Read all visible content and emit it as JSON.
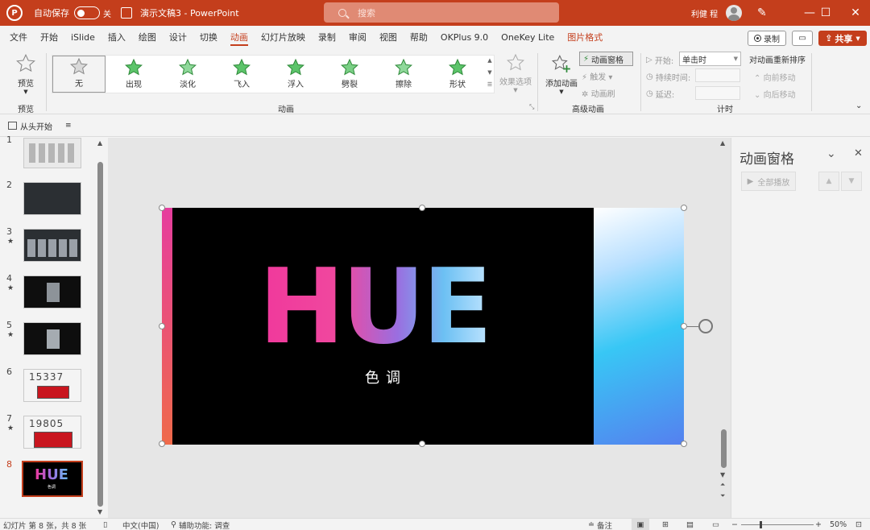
{
  "titlebar": {
    "app_icon": "P",
    "autosave_label": "自动保存",
    "autosave_state": "关",
    "doc_title": "演示文稿3  -  PowerPoint",
    "search_placeholder": "搜索",
    "user_name": "利健 程",
    "minimize": "—",
    "maximize": "☐",
    "close": "✕"
  },
  "menu": {
    "items": [
      "文件",
      "开始",
      "iSlide",
      "插入",
      "绘图",
      "设计",
      "切换",
      "动画",
      "幻灯片放映",
      "录制",
      "审阅",
      "视图",
      "帮助",
      "OKPlus 9.0",
      "OneKey Lite",
      "图片格式"
    ],
    "active_index": 7,
    "context_index": 15,
    "record_label": "录制",
    "share_label": "共享"
  },
  "ribbon": {
    "preview_label": "预览",
    "preview_group": "预览",
    "animations": [
      "无",
      "出现",
      "淡化",
      "飞入",
      "浮入",
      "劈裂",
      "擦除",
      "形状"
    ],
    "selected_animation": 0,
    "animation_group": "动画",
    "effect_options": "效果选项",
    "add_animation": "添加动画",
    "animation_pane": "动画窗格",
    "trigger": "触发",
    "painter": "动画刷",
    "advanced_group": "高级动画",
    "start_label": "开始:",
    "start_value": "单击时",
    "duration_label": "持续时间:",
    "delay_label": "延迟:",
    "timing_group": "计时",
    "reorder_title": "对动画重新排序",
    "move_earlier": "向前移动",
    "move_later": "向后移动"
  },
  "qat": {
    "play_from_start": "从头开始"
  },
  "thumbnails": [
    {
      "num": "1",
      "star": ""
    },
    {
      "num": "2",
      "star": ""
    },
    {
      "num": "3",
      "star": "★"
    },
    {
      "num": "4",
      "star": "★"
    },
    {
      "num": "5",
      "star": "★"
    },
    {
      "num": "6",
      "star": ""
    },
    {
      "num": "7",
      "star": "★"
    },
    {
      "num": "8",
      "star": ""
    }
  ],
  "thumb_text": {
    "t6": "15337",
    "t7": "19805",
    "t8": "HUE",
    "t8_sub": "色调"
  },
  "slide": {
    "title": "HUE",
    "subtitle": "色调"
  },
  "pane": {
    "title": "动画窗格",
    "play_all": "全部播放"
  },
  "status": {
    "slide_info": "幻灯片 第 8 张，共 8 张",
    "language": "中文(中国)",
    "accessibility": "辅助功能: 调查",
    "notes": "备注",
    "zoom": "50%"
  },
  "colors": {
    "accent": "#c43e1c"
  }
}
